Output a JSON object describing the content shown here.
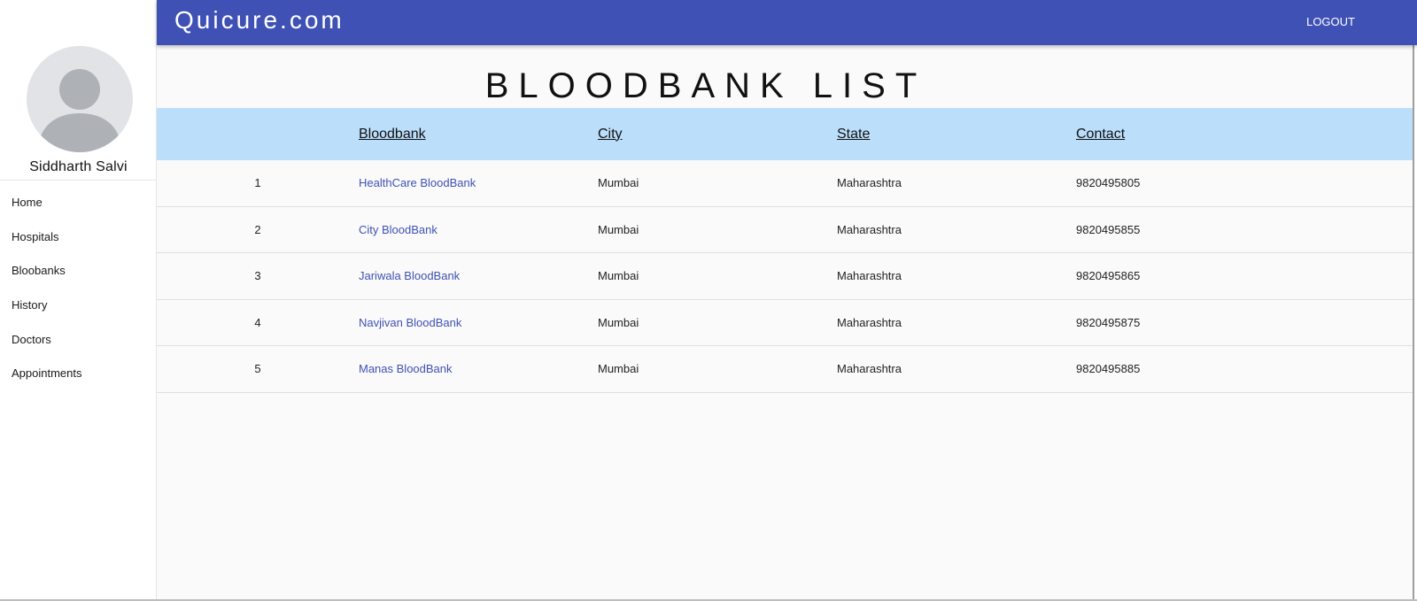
{
  "app": {
    "brand": "Quicure.com",
    "logout_label": "LOGOUT",
    "accent_color": "#3f51b5",
    "header_row_color": "#bbdefb"
  },
  "user": {
    "name": "Siddharth Salvi",
    "avatar_icon": "user-silhouette-icon"
  },
  "sidebar": {
    "items": [
      {
        "label": "Home"
      },
      {
        "label": "Hospitals"
      },
      {
        "label": "Bloobanks"
      },
      {
        "label": "History"
      },
      {
        "label": "Doctors"
      },
      {
        "label": "Appointments"
      }
    ]
  },
  "page": {
    "title": "BLOODBANK LIST"
  },
  "table": {
    "columns": [
      "",
      "Bloodbank",
      "City",
      "State",
      "Contact"
    ],
    "rows": [
      {
        "index": "1",
        "bloodbank": "HealthCare BloodBank",
        "city": "Mumbai",
        "state": "Maharashtra",
        "contact": "9820495805"
      },
      {
        "index": "2",
        "bloodbank": "City BloodBank",
        "city": "Mumbai",
        "state": "Maharashtra",
        "contact": "9820495855"
      },
      {
        "index": "3",
        "bloodbank": "Jariwala BloodBank",
        "city": "Mumbai",
        "state": "Maharashtra",
        "contact": "9820495865"
      },
      {
        "index": "4",
        "bloodbank": "Navjivan BloodBank",
        "city": "Mumbai",
        "state": "Maharashtra",
        "contact": "9820495875"
      },
      {
        "index": "5",
        "bloodbank": "Manas BloodBank",
        "city": "Mumbai",
        "state": "Maharashtra",
        "contact": "9820495885"
      }
    ]
  }
}
